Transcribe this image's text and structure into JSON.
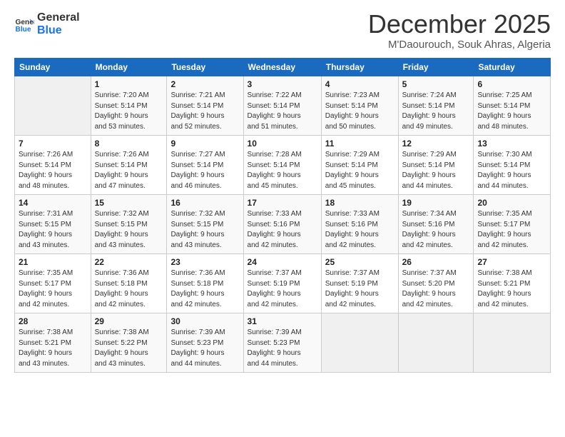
{
  "header": {
    "logo_line1": "General",
    "logo_line2": "Blue",
    "month": "December 2025",
    "location": "M'Daourouch, Souk Ahras, Algeria"
  },
  "weekdays": [
    "Sunday",
    "Monday",
    "Tuesday",
    "Wednesday",
    "Thursday",
    "Friday",
    "Saturday"
  ],
  "weeks": [
    [
      {
        "day": "",
        "info": ""
      },
      {
        "day": "1",
        "info": "Sunrise: 7:20 AM\nSunset: 5:14 PM\nDaylight: 9 hours\nand 53 minutes."
      },
      {
        "day": "2",
        "info": "Sunrise: 7:21 AM\nSunset: 5:14 PM\nDaylight: 9 hours\nand 52 minutes."
      },
      {
        "day": "3",
        "info": "Sunrise: 7:22 AM\nSunset: 5:14 PM\nDaylight: 9 hours\nand 51 minutes."
      },
      {
        "day": "4",
        "info": "Sunrise: 7:23 AM\nSunset: 5:14 PM\nDaylight: 9 hours\nand 50 minutes."
      },
      {
        "day": "5",
        "info": "Sunrise: 7:24 AM\nSunset: 5:14 PM\nDaylight: 9 hours\nand 49 minutes."
      },
      {
        "day": "6",
        "info": "Sunrise: 7:25 AM\nSunset: 5:14 PM\nDaylight: 9 hours\nand 48 minutes."
      }
    ],
    [
      {
        "day": "7",
        "info": "Sunrise: 7:26 AM\nSunset: 5:14 PM\nDaylight: 9 hours\nand 48 minutes."
      },
      {
        "day": "8",
        "info": "Sunrise: 7:26 AM\nSunset: 5:14 PM\nDaylight: 9 hours\nand 47 minutes."
      },
      {
        "day": "9",
        "info": "Sunrise: 7:27 AM\nSunset: 5:14 PM\nDaylight: 9 hours\nand 46 minutes."
      },
      {
        "day": "10",
        "info": "Sunrise: 7:28 AM\nSunset: 5:14 PM\nDaylight: 9 hours\nand 45 minutes."
      },
      {
        "day": "11",
        "info": "Sunrise: 7:29 AM\nSunset: 5:14 PM\nDaylight: 9 hours\nand 45 minutes."
      },
      {
        "day": "12",
        "info": "Sunrise: 7:29 AM\nSunset: 5:14 PM\nDaylight: 9 hours\nand 44 minutes."
      },
      {
        "day": "13",
        "info": "Sunrise: 7:30 AM\nSunset: 5:14 PM\nDaylight: 9 hours\nand 44 minutes."
      }
    ],
    [
      {
        "day": "14",
        "info": "Sunrise: 7:31 AM\nSunset: 5:15 PM\nDaylight: 9 hours\nand 43 minutes."
      },
      {
        "day": "15",
        "info": "Sunrise: 7:32 AM\nSunset: 5:15 PM\nDaylight: 9 hours\nand 43 minutes."
      },
      {
        "day": "16",
        "info": "Sunrise: 7:32 AM\nSunset: 5:15 PM\nDaylight: 9 hours\nand 43 minutes."
      },
      {
        "day": "17",
        "info": "Sunrise: 7:33 AM\nSunset: 5:16 PM\nDaylight: 9 hours\nand 42 minutes."
      },
      {
        "day": "18",
        "info": "Sunrise: 7:33 AM\nSunset: 5:16 PM\nDaylight: 9 hours\nand 42 minutes."
      },
      {
        "day": "19",
        "info": "Sunrise: 7:34 AM\nSunset: 5:16 PM\nDaylight: 9 hours\nand 42 minutes."
      },
      {
        "day": "20",
        "info": "Sunrise: 7:35 AM\nSunset: 5:17 PM\nDaylight: 9 hours\nand 42 minutes."
      }
    ],
    [
      {
        "day": "21",
        "info": "Sunrise: 7:35 AM\nSunset: 5:17 PM\nDaylight: 9 hours\nand 42 minutes."
      },
      {
        "day": "22",
        "info": "Sunrise: 7:36 AM\nSunset: 5:18 PM\nDaylight: 9 hours\nand 42 minutes."
      },
      {
        "day": "23",
        "info": "Sunrise: 7:36 AM\nSunset: 5:18 PM\nDaylight: 9 hours\nand 42 minutes."
      },
      {
        "day": "24",
        "info": "Sunrise: 7:37 AM\nSunset: 5:19 PM\nDaylight: 9 hours\nand 42 minutes."
      },
      {
        "day": "25",
        "info": "Sunrise: 7:37 AM\nSunset: 5:19 PM\nDaylight: 9 hours\nand 42 minutes."
      },
      {
        "day": "26",
        "info": "Sunrise: 7:37 AM\nSunset: 5:20 PM\nDaylight: 9 hours\nand 42 minutes."
      },
      {
        "day": "27",
        "info": "Sunrise: 7:38 AM\nSunset: 5:21 PM\nDaylight: 9 hours\nand 42 minutes."
      }
    ],
    [
      {
        "day": "28",
        "info": "Sunrise: 7:38 AM\nSunset: 5:21 PM\nDaylight: 9 hours\nand 43 minutes."
      },
      {
        "day": "29",
        "info": "Sunrise: 7:38 AM\nSunset: 5:22 PM\nDaylight: 9 hours\nand 43 minutes."
      },
      {
        "day": "30",
        "info": "Sunrise: 7:39 AM\nSunset: 5:23 PM\nDaylight: 9 hours\nand 44 minutes."
      },
      {
        "day": "31",
        "info": "Sunrise: 7:39 AM\nSunset: 5:23 PM\nDaylight: 9 hours\nand 44 minutes."
      },
      {
        "day": "",
        "info": ""
      },
      {
        "day": "",
        "info": ""
      },
      {
        "day": "",
        "info": ""
      }
    ]
  ]
}
